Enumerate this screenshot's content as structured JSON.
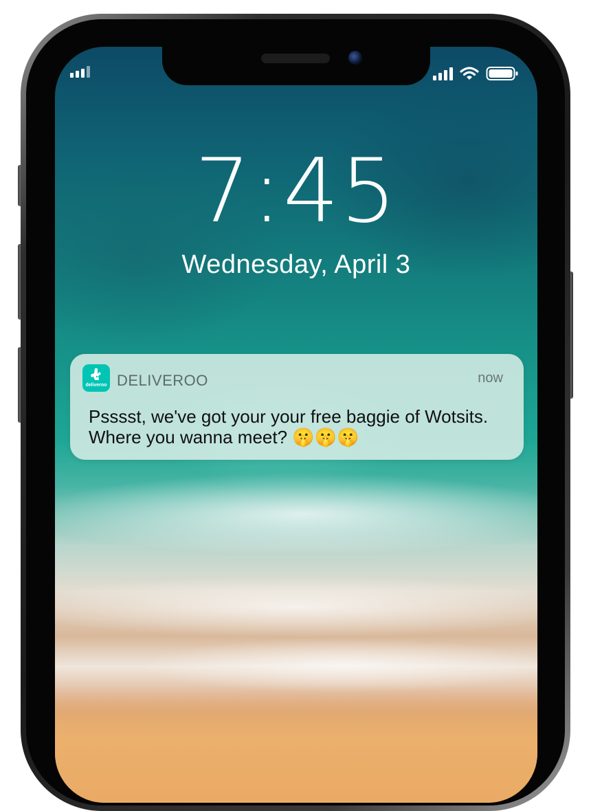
{
  "status_bar": {
    "left_icon": "signal-bars-icon",
    "right_icons": [
      "cellular-signal-icon",
      "wifi-icon",
      "battery-icon"
    ]
  },
  "lock_screen": {
    "time": "7:45",
    "date": "Wednesday, April 3"
  },
  "notification": {
    "app_name": "DELIVEROO",
    "app_icon_text": "deliveroo",
    "app_icon_color": "#00c4b4",
    "timestamp": "now",
    "message": "Psssst, we've got your your free baggie of Wotsits. Where you wanna meet?",
    "emojis": "🤫🤫🤫",
    "emoji_icon": "shushing-face-icon"
  },
  "colors": {
    "notification_bg": "#d6ece5",
    "text_primary": "#101010",
    "text_secondary": "#5d6b68"
  }
}
